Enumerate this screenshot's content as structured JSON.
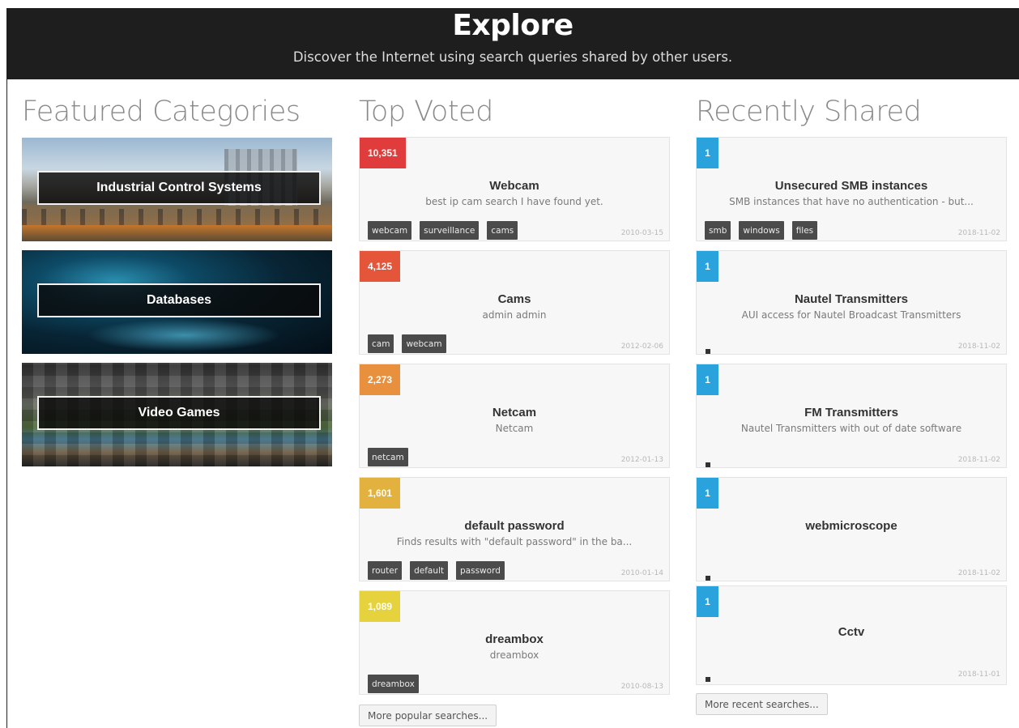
{
  "hero": {
    "title": "Explore",
    "subtitle": "Discover the Internet using search queries shared by other users."
  },
  "columns": {
    "featured": "Featured Categories",
    "top_voted": "Top Voted",
    "recent": "Recently Shared"
  },
  "featured_categories": [
    {
      "label": "Industrial Control Systems"
    },
    {
      "label": "Databases"
    },
    {
      "label": "Video Games"
    }
  ],
  "top_voted": [
    {
      "votes": "10,351",
      "badge_color": "#e03c3c",
      "title": "Webcam",
      "desc": "best ip cam search I have found yet.",
      "tags": [
        "webcam",
        "surveillance",
        "cams"
      ],
      "date": "2010-03-15"
    },
    {
      "votes": "4,125",
      "badge_color": "#e5553a",
      "title": "Cams",
      "desc": "admin admin",
      "tags": [
        "cam",
        "webcam"
      ],
      "date": "2012-02-06"
    },
    {
      "votes": "2,273",
      "badge_color": "#e8903e",
      "title": "Netcam",
      "desc": "Netcam",
      "tags": [
        "netcam"
      ],
      "date": "2012-01-13"
    },
    {
      "votes": "1,601",
      "badge_color": "#e3b23e",
      "title": "default password",
      "desc": "Finds results with \"default password\" in the ba...",
      "tags": [
        "router",
        "default",
        "password"
      ],
      "date": "2010-01-14"
    },
    {
      "votes": "1,089",
      "badge_color": "#e6d23c",
      "title": "dreambox",
      "desc": "dreambox",
      "tags": [
        "dreambox"
      ],
      "date": "2010-08-13"
    }
  ],
  "recent": [
    {
      "votes": "1",
      "title": "Unsecured SMB instances",
      "desc": "SMB instances that have no authentication - but...",
      "tags": [
        "smb",
        "windows",
        "files"
      ],
      "date": "2018-11-02"
    },
    {
      "votes": "1",
      "title": "Nautel Transmitters",
      "desc": "AUI access for Nautel Broadcast Transmitters",
      "tags": [],
      "date": "2018-11-02"
    },
    {
      "votes": "1",
      "title": "FM Transmitters",
      "desc": "Nautel Transmitters with out of date software",
      "tags": [],
      "date": "2018-11-02"
    },
    {
      "votes": "1",
      "title": "webmicroscope",
      "desc": "",
      "tags": [],
      "date": "2018-11-02"
    },
    {
      "votes": "1",
      "title": "Cctv",
      "desc": "",
      "tags": [],
      "date": "2018-11-01"
    }
  ],
  "recent_badge_color": "#2aa3dd",
  "buttons": {
    "more_popular": "More popular searches...",
    "more_recent": "More recent searches..."
  }
}
